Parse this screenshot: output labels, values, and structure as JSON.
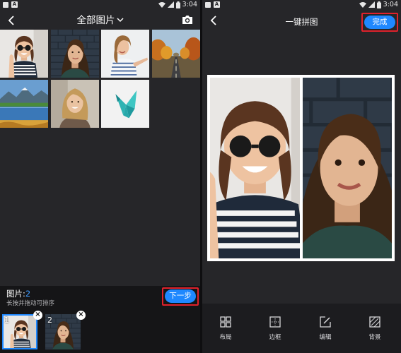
{
  "status_bar": {
    "time": "3:04"
  },
  "gallery_screen": {
    "title": "全部图片",
    "photos": [
      "girl-sunglasses-striped-shirt",
      "woman-brick-wall",
      "woman-striped-shirt-pointing",
      "autumn-road",
      "lake-landscape",
      "blonde-woman-smiling",
      "origami-crane"
    ],
    "selection": {
      "label": "图片:",
      "count": "2",
      "hint": "长按并拖动可排序",
      "next_label": "下一步",
      "items": [
        {
          "index": "1",
          "photo": "girl-sunglasses-striped-shirt"
        },
        {
          "index": "2",
          "photo": "woman-brick-wall"
        }
      ]
    }
  },
  "collage_screen": {
    "title": "一键拼图",
    "done_label": "完成",
    "cells": [
      "girl-sunglasses-striped-shirt",
      "woman-brick-wall"
    ],
    "tools": [
      {
        "label": "布局",
        "icon": "layout-icon"
      },
      {
        "label": "边框",
        "icon": "border-icon"
      },
      {
        "label": "编辑",
        "icon": "edit-icon"
      },
      {
        "label": "背景",
        "icon": "background-icon"
      }
    ]
  },
  "colors": {
    "accent": "#1e88ff",
    "highlight": "#e0212b",
    "background": "#262629"
  }
}
